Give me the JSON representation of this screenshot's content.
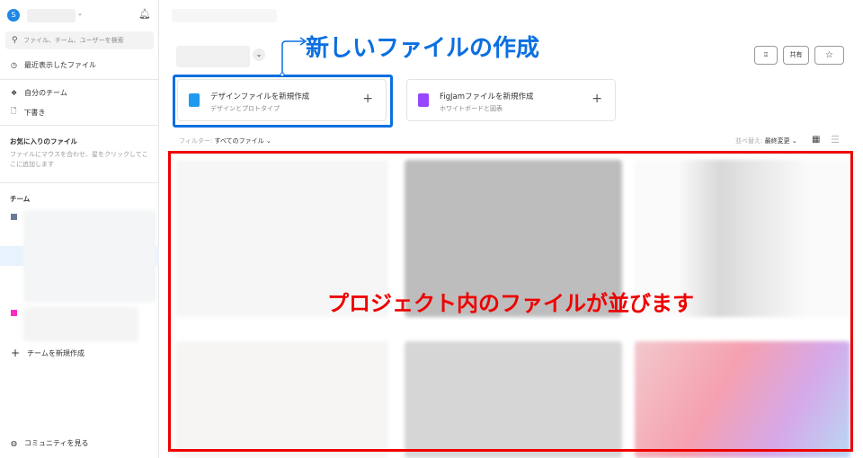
{
  "sidebar": {
    "avatar_initial": "S",
    "search_placeholder": "ファイル、チーム、ユーザーを検索",
    "recent": "最近表示したファイル",
    "my_team": "自分のチーム",
    "drafts": "下書き",
    "favorites_title": "お気に入りのファイル",
    "favorites_hint": "ファイルにマウスを合わせ、星をクリックしてここに追加します",
    "teams_title": "チーム",
    "team_colors": [
      "#6b7a99",
      "#ff2bc2"
    ],
    "new_team": "チームを新規作成",
    "community": "コミュニティを見る"
  },
  "header": {
    "share": "共有"
  },
  "cards": [
    {
      "title": "デザインファイルを新規作成",
      "subtitle": "デザインとプロトタイプ",
      "color": "#1e9bf0"
    },
    {
      "title": "FigJamファイルを新規作成",
      "subtitle": "ホワイトボードと図表",
      "color": "#9747ff"
    }
  ],
  "filter": {
    "label": "フィルター:",
    "value": "すべてのファイル"
  },
  "sort": {
    "label": "並べ替え:",
    "value": "最終変更"
  },
  "annotations": {
    "new_file": "新しいファイルの作成",
    "files": "プロジェクト内のファイルが並びます",
    "blue": "#0a6fe0",
    "red": "#ee0000"
  }
}
